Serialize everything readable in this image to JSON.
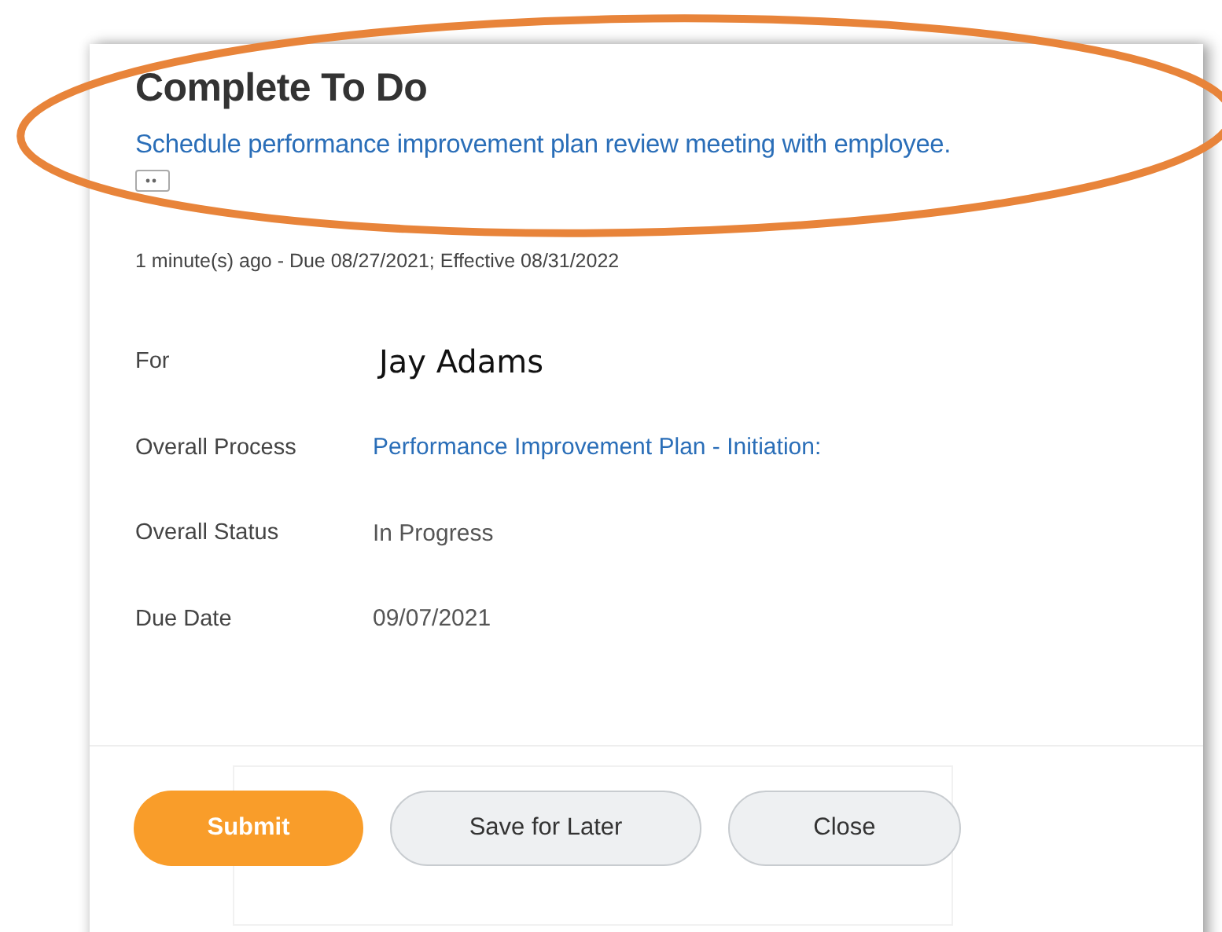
{
  "title": "Complete To Do",
  "task_link": "Schedule performance improvement plan review meeting with employee.",
  "meta": "1 minute(s) ago - Due 08/27/2021; Effective 08/31/2022",
  "fields": [
    {
      "label": "For",
      "value": "Jay Adams",
      "kind": "name"
    },
    {
      "label": "Overall Process",
      "value": "Performance Improvement Plan - Initiation:",
      "kind": "link"
    },
    {
      "label": "Overall Status",
      "value": "In Progress",
      "kind": "text"
    },
    {
      "label": "Due Date",
      "value": "09/07/2021",
      "kind": "text"
    }
  ],
  "buttons": [
    {
      "label": "Submit",
      "kind": "primary"
    },
    {
      "label": "Save for Later",
      "kind": "secondary"
    },
    {
      "label": "Close",
      "kind": "secondary"
    }
  ],
  "annotation": {
    "kind": "ellipse",
    "color": "#e8843a"
  }
}
